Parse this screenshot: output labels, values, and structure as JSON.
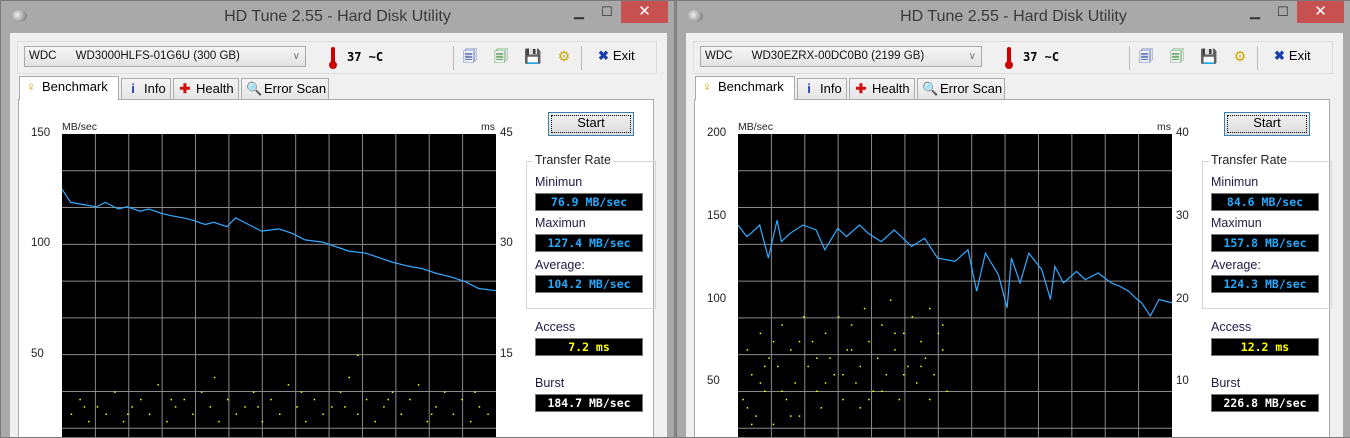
{
  "windows": [
    {
      "title": "HD Tune 2.55 - Hard Disk Utility",
      "drive": "WDC      WD3000HLFS-01G6U (300 GB)",
      "temperature": "37 ~C",
      "exit_label": "Exit",
      "tabs": [
        "Benchmark",
        "Info",
        "Health",
        "Error Scan"
      ],
      "start_label": "Start",
      "transfer_rate_label": "Transfer Rate",
      "minimum_label": "Minimun",
      "minimum": "76.9 MB/sec",
      "maximum_label": "Maximun",
      "maximum": "127.4 MB/sec",
      "average_label": "Average:",
      "average": "104.2 MB/sec",
      "access_label": "Access",
      "access": "7.2 ms",
      "burst_label": "Burst",
      "burst": "184.7 MB/sec",
      "chart_data": {
        "type": "line",
        "ylabel": "MB/sec",
        "y2label": "ms",
        "ylim": [
          0,
          150
        ],
        "y2lim": [
          0,
          45
        ],
        "yticks": [
          "150",
          "100",
          "50"
        ],
        "y2ticks": [
          "45",
          "30",
          "15"
        ],
        "grid": true,
        "transfer_series": {
          "x": [
            0,
            2,
            5,
            8,
            10,
            13,
            15,
            18,
            20,
            23,
            25,
            28,
            30,
            33,
            35,
            38,
            40,
            43,
            46,
            50,
            53,
            56,
            60,
            63,
            66,
            70,
            73,
            76,
            80,
            83,
            86,
            90,
            93,
            96,
            100
          ],
          "values": [
            125,
            119,
            118,
            117,
            119,
            116,
            117,
            115,
            116,
            114,
            113,
            112,
            111,
            109,
            110,
            108,
            112,
            109,
            106,
            107,
            105,
            102,
            101,
            99,
            97,
            96,
            94,
            92,
            90,
            89,
            87,
            85,
            83,
            80,
            79
          ]
        },
        "access_points": [
          [
            2,
            7
          ],
          [
            4,
            9
          ],
          [
            6,
            6
          ],
          [
            8,
            8
          ],
          [
            10,
            7
          ],
          [
            12,
            10
          ],
          [
            14,
            6
          ],
          [
            16,
            8
          ],
          [
            18,
            9
          ],
          [
            20,
            7
          ],
          [
            22,
            11
          ],
          [
            24,
            6
          ],
          [
            26,
            8
          ],
          [
            28,
            9
          ],
          [
            30,
            7
          ],
          [
            32,
            10
          ],
          [
            34,
            8
          ],
          [
            36,
            6
          ],
          [
            38,
            9
          ],
          [
            40,
            7
          ],
          [
            42,
            8
          ],
          [
            44,
            10
          ],
          [
            46,
            6
          ],
          [
            48,
            9
          ],
          [
            50,
            7
          ],
          [
            52,
            11
          ],
          [
            54,
            8
          ],
          [
            56,
            6
          ],
          [
            58,
            9
          ],
          [
            60,
            7
          ],
          [
            62,
            8
          ],
          [
            64,
            10
          ],
          [
            66,
            12
          ],
          [
            68,
            7
          ],
          [
            70,
            9
          ],
          [
            72,
            6
          ],
          [
            74,
            8
          ],
          [
            76,
            10
          ],
          [
            78,
            7
          ],
          [
            80,
            9
          ],
          [
            82,
            11
          ],
          [
            84,
            6
          ],
          [
            86,
            8
          ],
          [
            88,
            10
          ],
          [
            90,
            7
          ],
          [
            92,
            9
          ],
          [
            94,
            6
          ],
          [
            96,
            8
          ],
          [
            98,
            7
          ],
          [
            35,
            12
          ],
          [
            68,
            15
          ],
          [
            5,
            8
          ],
          [
            15,
            7
          ],
          [
            25,
            9
          ],
          [
            45,
            8
          ],
          [
            55,
            10
          ],
          [
            65,
            8
          ],
          [
            75,
            9
          ],
          [
            85,
            7
          ],
          [
            95,
            10
          ]
        ]
      }
    },
    {
      "title": "HD Tune 2.55 - Hard Disk Utility",
      "drive": "WDC      WD30EZRX-00DC0B0 (2199 GB)",
      "temperature": "37 ~C",
      "exit_label": "Exit",
      "tabs": [
        "Benchmark",
        "Info",
        "Health",
        "Error Scan"
      ],
      "start_label": "Start",
      "transfer_rate_label": "Transfer Rate",
      "minimum_label": "Minimun",
      "minimum": "84.6 MB/sec",
      "maximum_label": "Maximun",
      "maximum": "157.8 MB/sec",
      "average_label": "Average:",
      "average": "124.3 MB/sec",
      "access_label": "Access",
      "access": "12.2 ms",
      "burst_label": "Burst",
      "burst": "226.8 MB/sec",
      "chart_data": {
        "type": "line",
        "ylabel": "MB/sec",
        "y2label": "ms",
        "ylim": [
          0,
          200
        ],
        "y2lim": [
          0,
          40
        ],
        "yticks": [
          "200",
          "150",
          "100",
          "50"
        ],
        "y2ticks": [
          "40",
          "30",
          "20",
          "10"
        ],
        "grid": true,
        "transfer_series": {
          "x": [
            0,
            2,
            3,
            5,
            7,
            9,
            10,
            12,
            15,
            18,
            20,
            23,
            25,
            28,
            30,
            33,
            36,
            40,
            43,
            46,
            50,
            53,
            55,
            57,
            60,
            62,
            63,
            65,
            67,
            70,
            72,
            73,
            75,
            78,
            80,
            83,
            86,
            88,
            90,
            92,
            93,
            95,
            97,
            100
          ],
          "values": [
            145,
            138,
            140,
            145,
            125,
            148,
            135,
            140,
            145,
            142,
            130,
            143,
            138,
            145,
            140,
            135,
            142,
            132,
            137,
            125,
            123,
            130,
            105,
            128,
            115,
            95,
            125,
            110,
            128,
            118,
            100,
            120,
            110,
            117,
            112,
            116,
            110,
            108,
            105,
            100,
            98,
            90,
            100,
            98
          ]
        },
        "access_points": [
          [
            1,
            8
          ],
          [
            2,
            14
          ],
          [
            3,
            11
          ],
          [
            4,
            6
          ],
          [
            5,
            16
          ],
          [
            6,
            9
          ],
          [
            7,
            13
          ],
          [
            8,
            5
          ],
          [
            9,
            12
          ],
          [
            10,
            17
          ],
          [
            11,
            8
          ],
          [
            12,
            14
          ],
          [
            13,
            10
          ],
          [
            14,
            6
          ],
          [
            15,
            18
          ],
          [
            16,
            12
          ],
          [
            17,
            15
          ],
          [
            18,
            9
          ],
          [
            19,
            7
          ],
          [
            20,
            16
          ],
          [
            21,
            13
          ],
          [
            22,
            11
          ],
          [
            23,
            18
          ],
          [
            24,
            8
          ],
          [
            25,
            14
          ],
          [
            26,
            17
          ],
          [
            27,
            10
          ],
          [
            28,
            12
          ],
          [
            29,
            19
          ],
          [
            30,
            15
          ],
          [
            31,
            9
          ],
          [
            32,
            13
          ],
          [
            33,
            17
          ],
          [
            34,
            11
          ],
          [
            35,
            20
          ],
          [
            36,
            14
          ],
          [
            37,
            8
          ],
          [
            38,
            16
          ],
          [
            39,
            12
          ],
          [
            40,
            18
          ],
          [
            41,
            10
          ],
          [
            42,
            15
          ],
          [
            43,
            13
          ],
          [
            44,
            19
          ],
          [
            45,
            11
          ],
          [
            46,
            16
          ],
          [
            47,
            14
          ],
          [
            48,
            9
          ],
          [
            2,
            7
          ],
          [
            5,
            10
          ],
          [
            8,
            15
          ],
          [
            12,
            6
          ],
          [
            18,
            13
          ],
          [
            24,
            11
          ],
          [
            28,
            7
          ],
          [
            33,
            9
          ],
          [
            38,
            11
          ],
          [
            44,
            8
          ],
          [
            3,
            5
          ],
          [
            6,
            12
          ],
          [
            10,
            9
          ],
          [
            14,
            15
          ],
          [
            20,
            10
          ],
          [
            26,
            14
          ],
          [
            30,
            8
          ],
          [
            36,
            16
          ],
          [
            42,
            12
          ],
          [
            47,
            17
          ]
        ]
      }
    }
  ],
  "colors": {
    "transfer_line": "#33aaff",
    "access_points": "#ffff00",
    "chart_bg": "#000000",
    "grid": "#8a8a8a",
    "close_button": "#c75050"
  }
}
